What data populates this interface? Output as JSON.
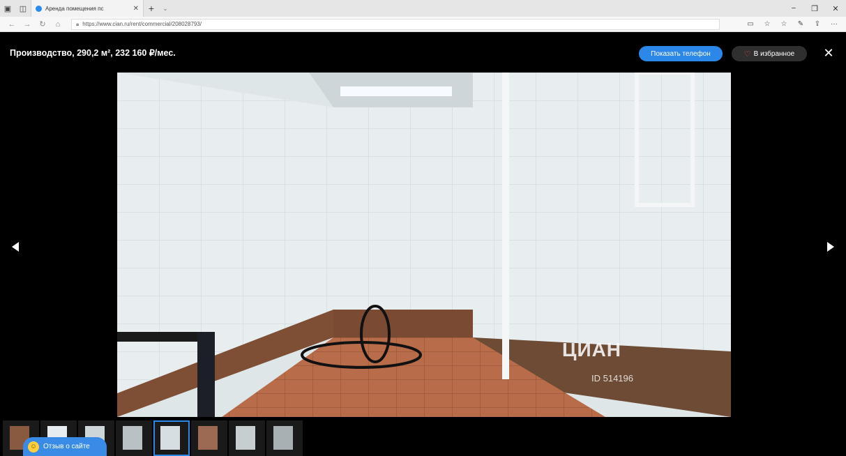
{
  "browser": {
    "tab_title": "Аренда помещения пс",
    "url": "https://www.cian.ru/rent/commercial/208028793/"
  },
  "listing": {
    "title": "Производство, 290,2 м², 232 160 ₽/мес.",
    "show_phone": "Показать телефон",
    "favorite": "В избранное",
    "close_icon": "close-icon"
  },
  "photo": {
    "watermark_brand": "ЦИАН",
    "watermark_id": "ID 514196"
  },
  "thumbnails": {
    "count": 8,
    "active_index": 4
  },
  "feedback": {
    "label": "Отзыв о сайте"
  },
  "colors": {
    "accent": "#2b87e8",
    "favorite_heart": "#ff4d5e",
    "background": "#000000"
  }
}
